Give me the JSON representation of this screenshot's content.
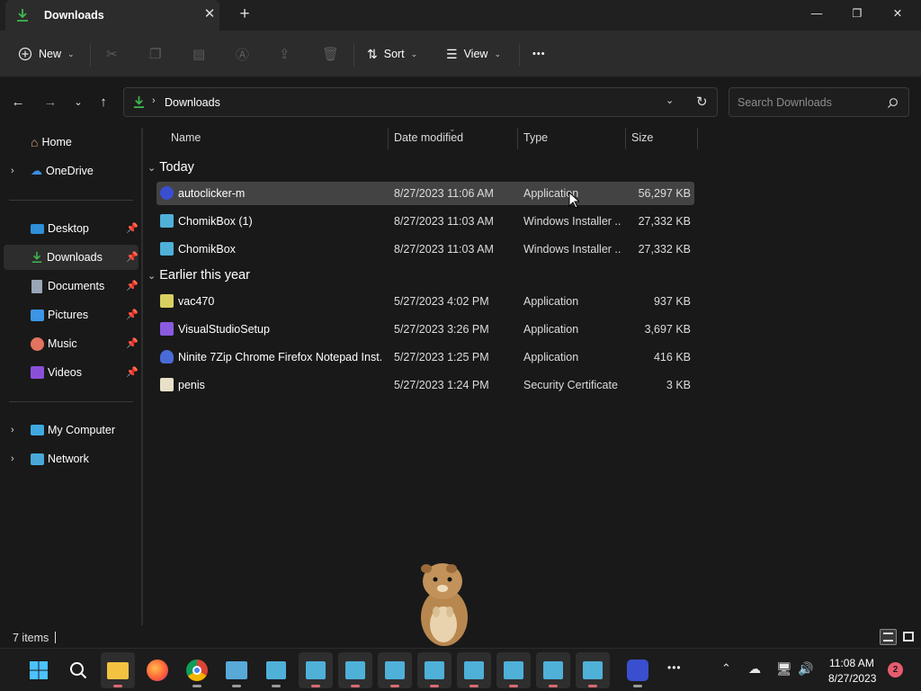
{
  "window": {
    "tab_title": "Downloads",
    "tab_close": "✕",
    "new_tab": "+",
    "minimize": "—",
    "maximize": "❐",
    "close": "✕"
  },
  "toolbar": {
    "new_label": "New",
    "sort_label": "Sort",
    "view_label": "View",
    "more_label": "•••"
  },
  "address": {
    "path_segment": "Downloads",
    "search_placeholder": "Search Downloads"
  },
  "sidebar": {
    "home": "Home",
    "onedrive": "OneDrive",
    "desktop": "Desktop",
    "downloads": "Downloads",
    "documents": "Documents",
    "pictures": "Pictures",
    "music": "Music",
    "videos": "Videos",
    "my_computer": "My Computer",
    "network": "Network"
  },
  "columns": {
    "name": "Name",
    "date": "Date modified",
    "type": "Type",
    "size": "Size"
  },
  "groups": {
    "today": "Today",
    "earlier": "Earlier this year"
  },
  "files": [
    {
      "name": "autoclicker-m",
      "date": "8/27/2023 11:06 AM",
      "type": "Application",
      "size": "56,297 KB",
      "icon": "autoclicker-icon"
    },
    {
      "name": "ChomikBox (1)",
      "date": "8/27/2023 11:03 AM",
      "type": "Windows Installer ...",
      "size": "27,332 KB",
      "icon": "installer-icon"
    },
    {
      "name": "ChomikBox",
      "date": "8/27/2023 11:03 AM",
      "type": "Windows Installer ...",
      "size": "27,332 KB",
      "icon": "installer-icon"
    },
    {
      "name": "vac470",
      "date": "5/27/2023 4:02 PM",
      "type": "Application",
      "size": "937 KB",
      "icon": "app-icon"
    },
    {
      "name": "VisualStudioSetup",
      "date": "5/27/2023 3:26 PM",
      "type": "Application",
      "size": "3,697 KB",
      "icon": "visual-studio-icon"
    },
    {
      "name": "Ninite 7Zip Chrome Firefox Notepad Inst...",
      "date": "5/27/2023 1:25 PM",
      "type": "Application",
      "size": "416 KB",
      "icon": "ninite-icon"
    },
    {
      "name": "penis",
      "date": "5/27/2023 1:24 PM",
      "type": "Security Certificate",
      "size": "3 KB",
      "icon": "certificate-icon"
    }
  ],
  "status": {
    "item_count": "7 items"
  },
  "taskbar": {
    "clock_time": "11:08 AM",
    "clock_date": "8/27/2023",
    "notification_count": "2",
    "more_label": "•••"
  },
  "colors": {
    "accent_green": "#3fb950",
    "selection": "#434343",
    "badge": "#e85b6f"
  }
}
